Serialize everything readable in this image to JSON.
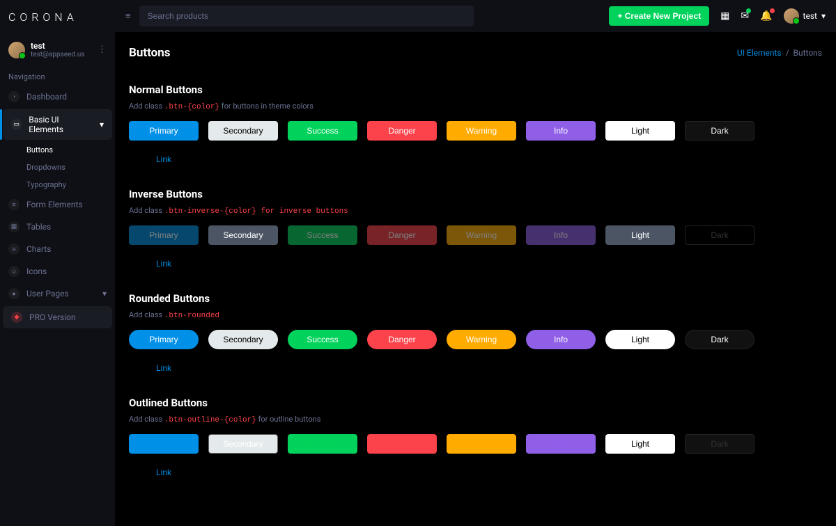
{
  "brand": "CORONA",
  "user": {
    "name": "test",
    "email": "test@appseed.us"
  },
  "nav_header": "Navigation",
  "nav": {
    "dashboard": "Dashboard",
    "basic_ui": "Basic UI Elements",
    "buttons": "Buttons",
    "dropdowns": "Dropdowns",
    "typography": "Typography",
    "form_elements": "Form Elements",
    "tables": "Tables",
    "charts": "Charts",
    "icons": "Icons",
    "user_pages": "User Pages",
    "pro": "PRO Version"
  },
  "topbar": {
    "search_placeholder": "Search products",
    "create_label": "+ Create New Project",
    "user_label": "test"
  },
  "page": {
    "title": "Buttons",
    "breadcrumb_parent": "UI Elements",
    "breadcrumb_sep": "/",
    "breadcrumb_current": "Buttons"
  },
  "sections": {
    "normal": {
      "title": "Normal Buttons",
      "desc_pre": "Add class ",
      "desc_code": ".btn-{color}",
      "desc_post": " for buttons in theme colors"
    },
    "inverse": {
      "title": "Inverse Buttons",
      "desc_pre": "Add class ",
      "desc_code": ".btn-inverse-{color} for inverse buttons",
      "desc_post": ""
    },
    "rounded": {
      "title": "Rounded Buttons",
      "desc_pre": "Add class ",
      "desc_code": ".btn-rounded",
      "desc_post": ""
    },
    "outlined": {
      "title": "Outlined Buttons",
      "desc_pre": "Add class ",
      "desc_code": ".btn-outline-{color}",
      "desc_post": " for outline buttons"
    }
  },
  "btn_labels": {
    "primary": "Primary",
    "secondary": "Secondary",
    "success": "Success",
    "danger": "Danger",
    "warning": "Warning",
    "info": "Info",
    "light": "Light",
    "dark": "Dark",
    "link": "Link"
  }
}
